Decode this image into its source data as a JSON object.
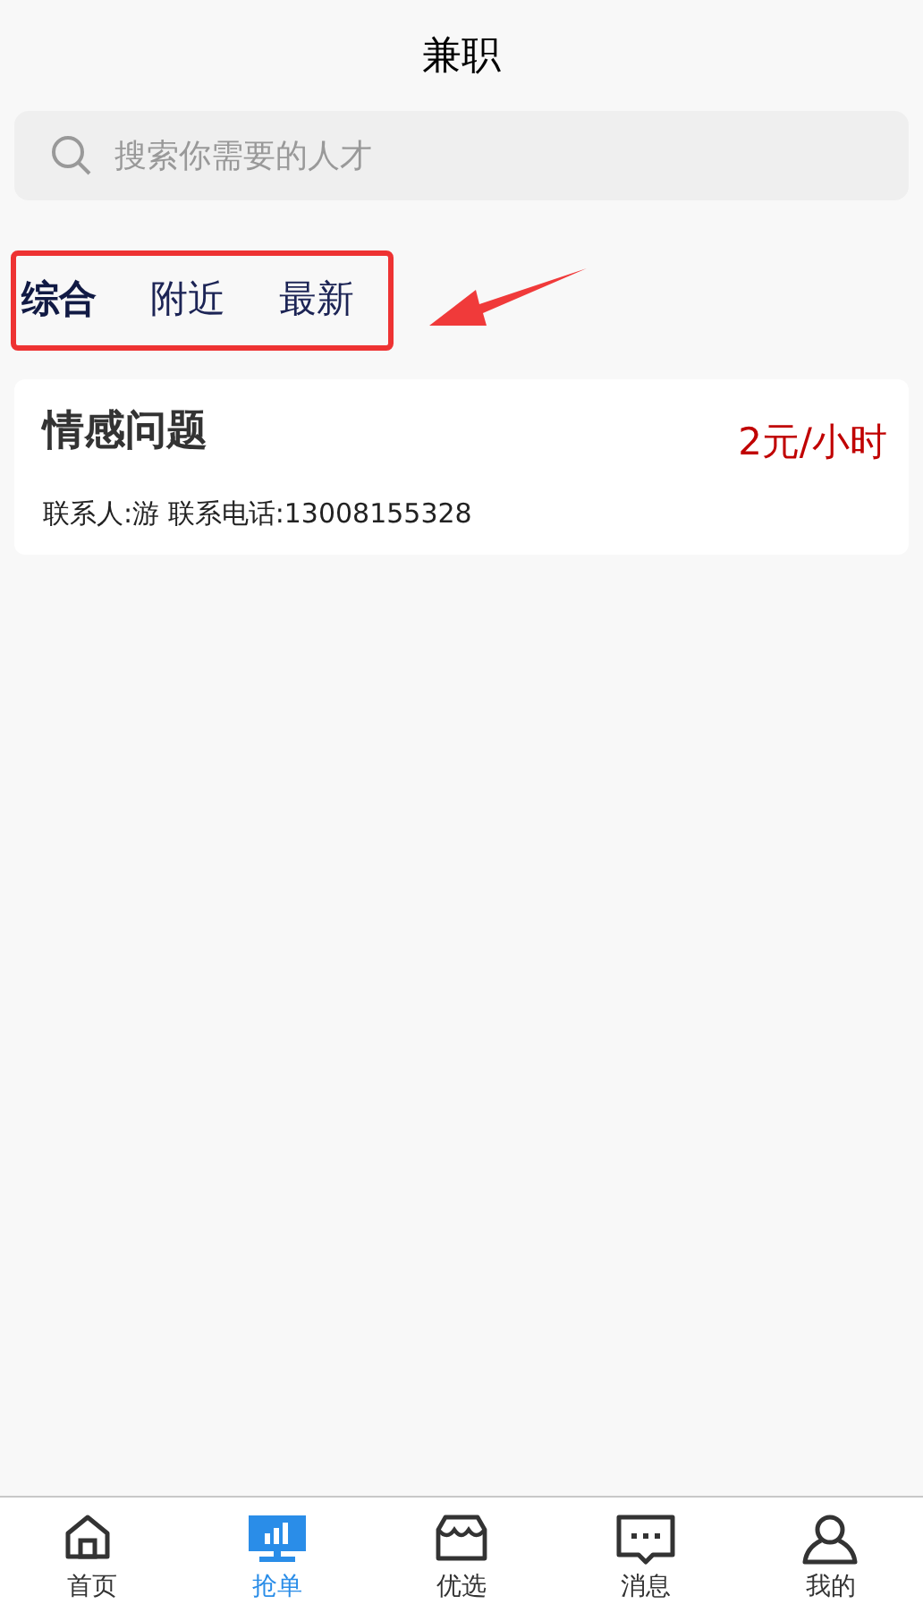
{
  "header": {
    "title": "兼职"
  },
  "search": {
    "placeholder": "搜索你需要的人才"
  },
  "filter_tabs": {
    "annotated": true,
    "items": [
      {
        "label": "综合",
        "selected": true
      },
      {
        "label": "附近",
        "selected": false
      },
      {
        "label": "最新",
        "selected": false
      }
    ]
  },
  "jobs": [
    {
      "title": "情感问题",
      "price": "2元/小时",
      "contact": "联系人:游 联系电话:13008155328"
    }
  ],
  "bottom_nav": [
    {
      "label": "首页",
      "kind": "home",
      "selected": false
    },
    {
      "label": "抢单",
      "kind": "chart",
      "selected": true
    },
    {
      "label": "优选",
      "kind": "shop",
      "selected": false
    },
    {
      "label": "消息",
      "kind": "message",
      "selected": false
    },
    {
      "label": "我的",
      "kind": "user",
      "selected": false
    }
  ]
}
